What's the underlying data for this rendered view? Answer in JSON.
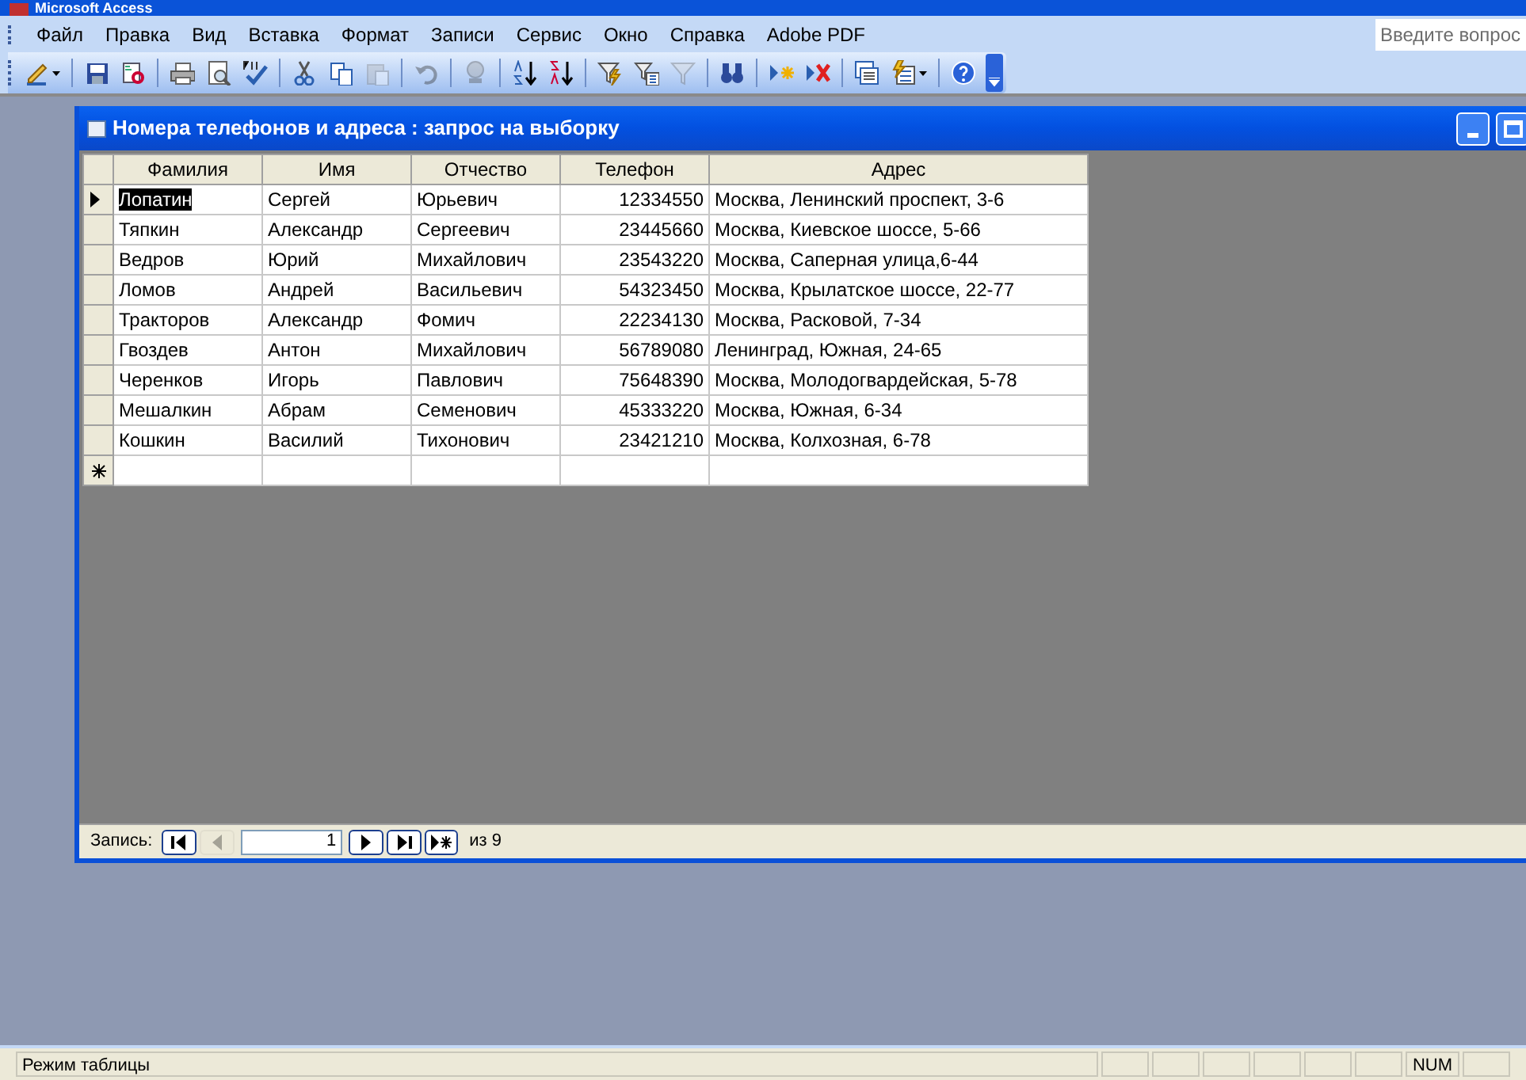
{
  "app_title": "Microsoft Access",
  "menu": [
    "Файл",
    "Правка",
    "Вид",
    "Вставка",
    "Формат",
    "Записи",
    "Сервис",
    "Окно",
    "Справка",
    "Adobe PDF"
  ],
  "help_box": {
    "placeholder": "Введите вопрос"
  },
  "toolbar": [
    {
      "kind": "design",
      "disabled": false,
      "dropdown": true
    },
    {
      "kind": "sep"
    },
    {
      "kind": "save",
      "disabled": false
    },
    {
      "kind": "search",
      "disabled": false
    },
    {
      "kind": "sep"
    },
    {
      "kind": "print",
      "disabled": false
    },
    {
      "kind": "preview",
      "disabled": false
    },
    {
      "kind": "spelling",
      "disabled": false
    },
    {
      "kind": "sep"
    },
    {
      "kind": "cut",
      "disabled": false
    },
    {
      "kind": "copy",
      "disabled": false
    },
    {
      "kind": "paste",
      "disabled": true
    },
    {
      "kind": "sep"
    },
    {
      "kind": "undo",
      "disabled": true
    },
    {
      "kind": "sep"
    },
    {
      "kind": "hyperlink",
      "disabled": true
    },
    {
      "kind": "sep"
    },
    {
      "kind": "sort_asc",
      "disabled": false
    },
    {
      "kind": "sort_desc",
      "disabled": false
    },
    {
      "kind": "sep"
    },
    {
      "kind": "filter_selection",
      "disabled": false
    },
    {
      "kind": "filter_form",
      "disabled": false
    },
    {
      "kind": "filter",
      "disabled": true
    },
    {
      "kind": "sep"
    },
    {
      "kind": "find",
      "disabled": false
    },
    {
      "kind": "sep"
    },
    {
      "kind": "new_record",
      "disabled": false
    },
    {
      "kind": "delete_record",
      "disabled": false
    },
    {
      "kind": "sep"
    },
    {
      "kind": "database_window",
      "disabled": false
    },
    {
      "kind": "new_object",
      "disabled": false,
      "dropdown": true
    },
    {
      "kind": "sep"
    },
    {
      "kind": "help",
      "disabled": false
    }
  ],
  "window": {
    "title": "Номера телефонов и адреса : запрос на выборку"
  },
  "table": {
    "columns": [
      "Фамилия",
      "Имя",
      "Отчество",
      "Телефон",
      "Адрес"
    ],
    "rows": [
      {
        "selected": true,
        "cells": [
          "Лопатин",
          "Сергей",
          "Юрьевич",
          "12334550",
          "Москва, Ленинский проспект, 3-6"
        ]
      },
      {
        "selected": false,
        "cells": [
          "Тяпкин",
          "Александр",
          "Сергеевич",
          "23445660",
          "Москва, Киевское шоссе, 5-66"
        ]
      },
      {
        "selected": false,
        "cells": [
          "Ведров",
          "Юрий",
          "Михайлович",
          "23543220",
          "Москва, Саперная улица,6-44"
        ]
      },
      {
        "selected": false,
        "cells": [
          "Ломов",
          "Андрей",
          "Васильевич",
          "54323450",
          "Москва, Крылатское шоссе, 22-77"
        ]
      },
      {
        "selected": false,
        "cells": [
          "Тракторов",
          "Александр",
          "Фомич",
          "22234130",
          "Москва, Расковой, 7-34"
        ]
      },
      {
        "selected": false,
        "cells": [
          "Гвоздев",
          "Антон",
          "Михайлович",
          "56789080",
          "Ленинград, Южная, 24-65"
        ]
      },
      {
        "selected": false,
        "cells": [
          "Черенков",
          "Игорь",
          "Павлович",
          "75648390",
          "Москва, Молодогвардейская, 5-78"
        ]
      },
      {
        "selected": false,
        "cells": [
          "Мешалкин",
          "Абрам",
          "Семенович",
          "45333220",
          "Москва, Южная, 6-34"
        ]
      },
      {
        "selected": false,
        "cells": [
          "Кошкин",
          "Василий",
          "Тихонович",
          "23421210",
          "Москва, Колхозная, 6-78"
        ]
      }
    ]
  },
  "navigator": {
    "label": "Запись:",
    "record": "1",
    "total": "из 9",
    "buttons": [
      {
        "kind": "first",
        "disabled": false
      },
      {
        "kind": "prev",
        "disabled": true
      },
      {
        "kind": "field"
      },
      {
        "kind": "next",
        "disabled": false
      },
      {
        "kind": "last",
        "disabled": false
      },
      {
        "kind": "new",
        "disabled": false
      }
    ]
  },
  "status_bar": {
    "mode": "Режим таблицы",
    "indicator": "NUM"
  }
}
